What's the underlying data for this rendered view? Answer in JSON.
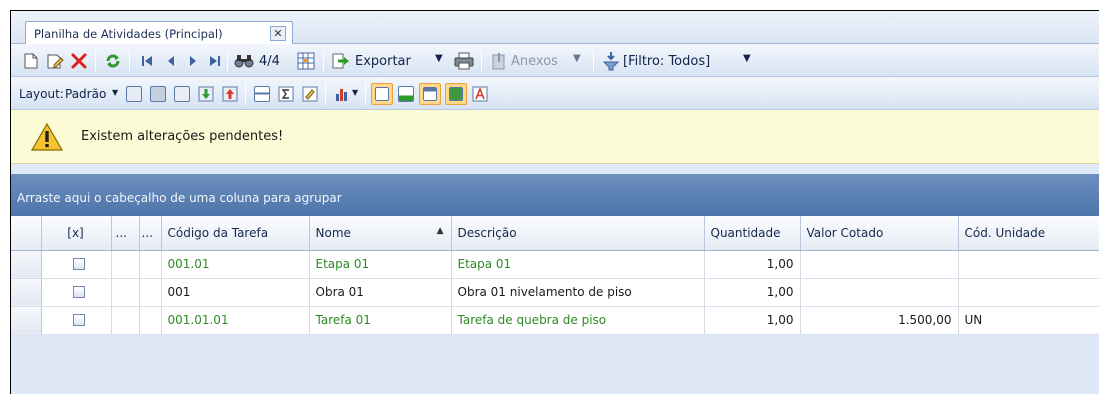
{
  "tab": {
    "title": "Planilha de Atividades (Principal)",
    "close_glyph": "✕"
  },
  "toolbar": {
    "record_counter": "4/4",
    "export_label": "Exportar",
    "attachments_label": "Anexos",
    "filter_label": "[Filtro: Todos]",
    "dropdown_glyph": "▼"
  },
  "layout_bar": {
    "layout_label": "Layout:",
    "layout_value": "Padrão"
  },
  "warning": {
    "message": "Existem alterações pendentes!"
  },
  "group_panel": {
    "hint": "Arraste aqui o cabeçalho de uma coluna para agrupar"
  },
  "grid": {
    "columns": {
      "check": "[x]",
      "dots1": "...",
      "dots2": "...",
      "code": "Código da Tarefa",
      "name": "Nome",
      "desc": "Descrição",
      "qty": "Quantidade",
      "value": "Valor Cotado",
      "unit": "Cód. Unidade"
    },
    "rows": [
      {
        "code": "001.01",
        "name": "Etapa 01",
        "desc": "Etapa 01",
        "qty": "1,00",
        "value": "",
        "unit": ""
      },
      {
        "code": "001",
        "name": "Obra 01",
        "desc": "Obra 01  nivelamento de piso",
        "qty": "1,00",
        "value": "",
        "unit": ""
      },
      {
        "code": "001.01.01",
        "name": "Tarefa 01",
        "desc": "Tarefa de quebra de piso",
        "qty": "1,00",
        "value": "1.500,00",
        "unit": "UN"
      }
    ]
  },
  "colors": {
    "accent_blue": "#4e74aa",
    "row_green": "#2f8a25",
    "warning_bg": "#fbfbd6",
    "highlight": "#ffd88a"
  }
}
